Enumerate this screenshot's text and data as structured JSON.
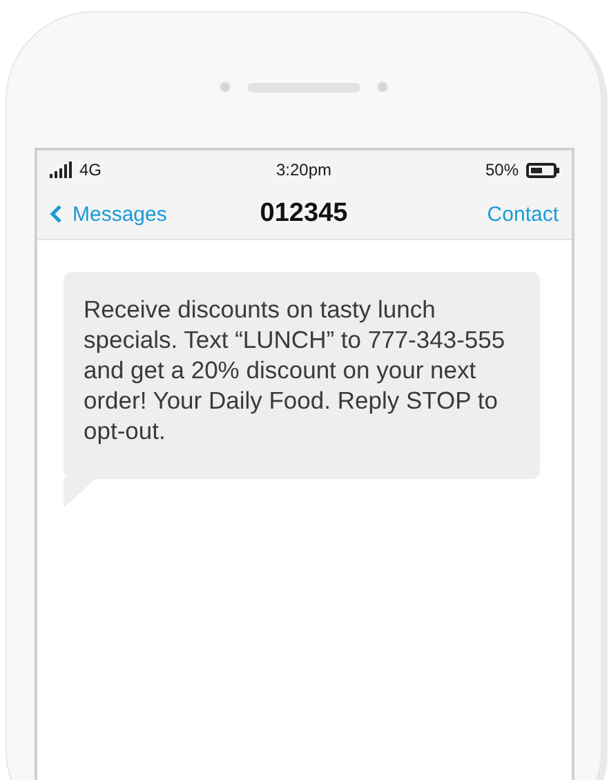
{
  "status_bar": {
    "network": "4G",
    "time": "3:20pm",
    "battery": "50%"
  },
  "nav_bar": {
    "back": "Messages",
    "title": "012345",
    "action": "Contact"
  },
  "messages": [
    {
      "kind": "received",
      "text": "Receive discounts on tasty lunch specials. Text “LUNCH” to 777-343-555 and get a 20% discount on your next order! Your Daily Food. Reply STOP to opt-out."
    }
  ]
}
